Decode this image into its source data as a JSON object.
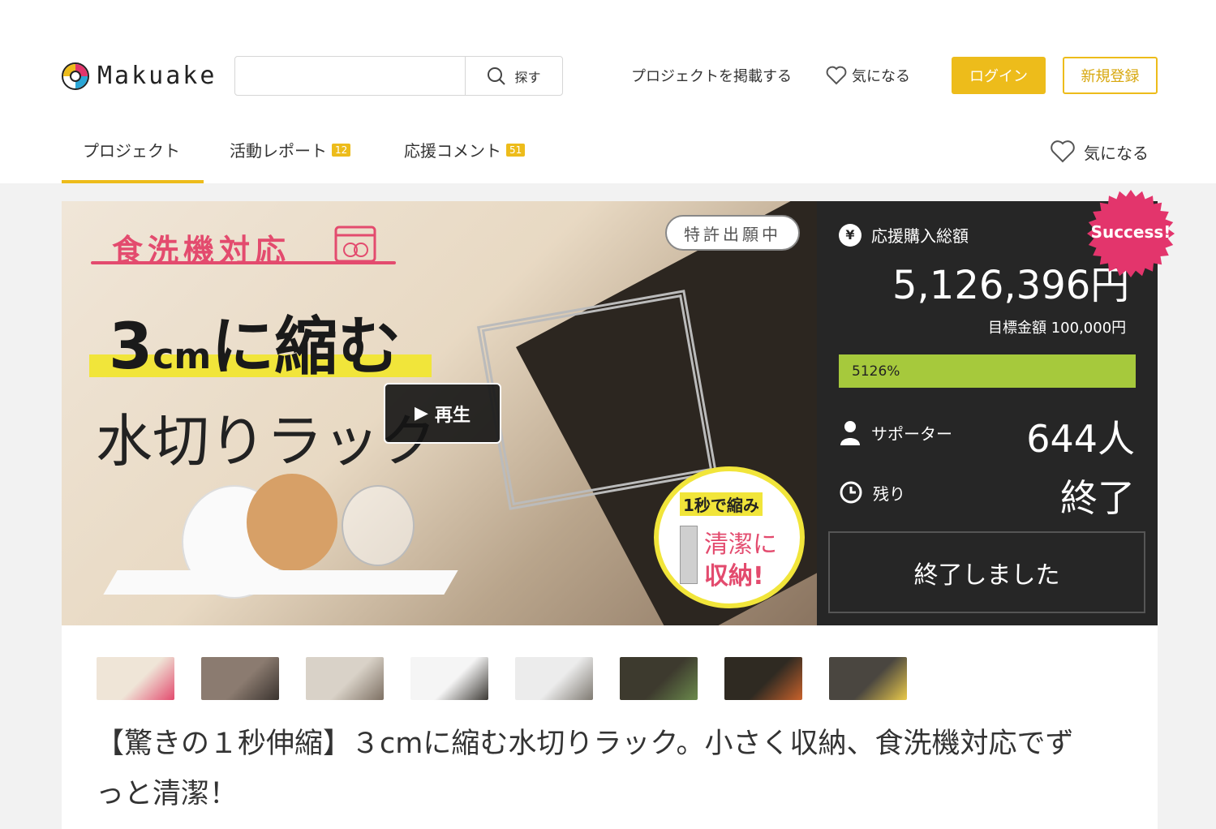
{
  "header": {
    "logo_text": "Makuake",
    "search": {
      "placeholder": "",
      "button_label": "探す"
    },
    "post_project": "プロジェクトを掲載する",
    "favorite": "気になる",
    "login": "ログイン",
    "signup": "新規登録"
  },
  "tabs": [
    {
      "label": "プロジェクト",
      "badge": ""
    },
    {
      "label": "活動レポート",
      "badge": "12"
    },
    {
      "label": "応援コメント",
      "badge": "51"
    }
  ],
  "tab_favorite": "気になる",
  "hero": {
    "title1": "食洗機対応",
    "title2_num": "3",
    "title2_unit": "cm",
    "title2_rest": "に縮む",
    "title3": "水切りラック",
    "patent_tag": "特許出願中",
    "play_label": "再生",
    "bubble_line1": "1秒で縮み",
    "bubble_line2": "清潔に",
    "bubble_line3": "収納!"
  },
  "stats": {
    "total_label": "応援購入総額",
    "amount": "5,126,396円",
    "goal": "目標金額 100,000円",
    "percent_label": "5126%",
    "percent_value": 5126,
    "supporters_label": "サポーター",
    "supporters": "644人",
    "remaining_label": "残り",
    "remaining": "終了",
    "ended_button": "終了しました",
    "success_badge": "Success!"
  },
  "thumbnails": [
    {
      "name": "thumb-1",
      "colors": [
        "#efe5d7",
        "#e34b6e"
      ]
    },
    {
      "name": "thumb-2",
      "colors": [
        "#8b7b70",
        "#3a332e"
      ]
    },
    {
      "name": "thumb-3",
      "colors": [
        "#d9d2c8",
        "#7d7063"
      ]
    },
    {
      "name": "thumb-4",
      "colors": [
        "#f5f5f5",
        "#3d3a35"
      ]
    },
    {
      "name": "thumb-5",
      "colors": [
        "#ececec",
        "#7f7a72"
      ]
    },
    {
      "name": "thumb-6",
      "colors": [
        "#3d3a2e",
        "#6b8a4c"
      ]
    },
    {
      "name": "thumb-7",
      "colors": [
        "#2f2a22",
        "#c9622b"
      ]
    },
    {
      "name": "thumb-8",
      "colors": [
        "#4a4640",
        "#e9c94a"
      ]
    }
  ],
  "page_title": "【驚きの１秒伸縮】３cmに縮む水切りラック。小さく収納、食洗機対応でずっと清潔！",
  "colors": {
    "accent": "#edbc1b",
    "progress": "#a6c93c",
    "success": "#e3356c",
    "panel": "#262626"
  }
}
